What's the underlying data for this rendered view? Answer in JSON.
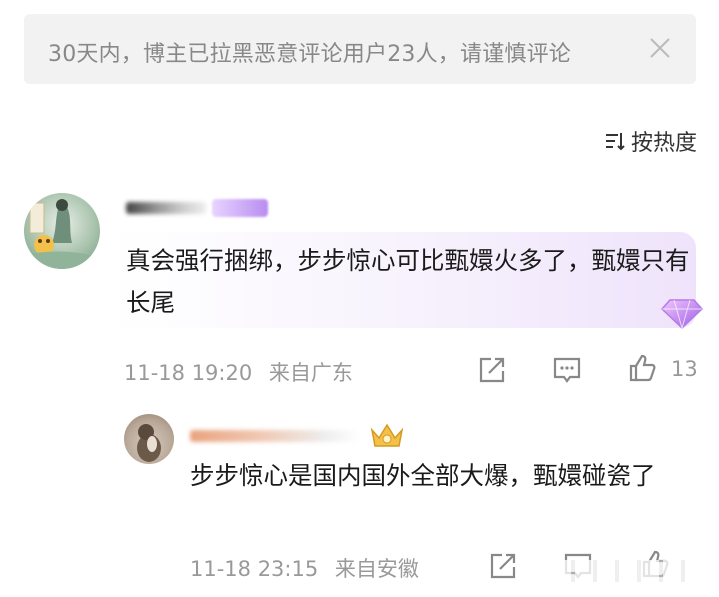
{
  "notice": {
    "text": "30天内，博主已拉黑恶意评论用户23人，请谨慎评论",
    "close_icon": "close-icon"
  },
  "sort": {
    "label": "按热度",
    "icon": "sort-icon"
  },
  "comments": [
    {
      "text": "真会强行捆绑，步步惊心可比甄嬛火多了，甄嬛只有长尾",
      "time": "11-18 19:20",
      "location": "来自广东",
      "likes": "13"
    }
  ],
  "replies": [
    {
      "text": "步步惊心是国内国外全部大爆，甄嬛碰瓷了",
      "time": "11-18 23:15",
      "location": "来自安徽"
    }
  ],
  "colors": {
    "bubble_accent": "#efe3fb",
    "meta_gray": "#999999",
    "notice_bg": "#f2f2f2"
  }
}
